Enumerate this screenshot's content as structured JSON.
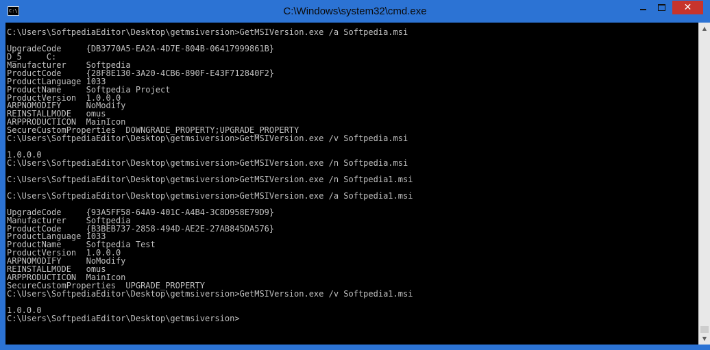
{
  "window": {
    "title": "C:\\Windows\\system32\\cmd.exe",
    "icon": "cmd-console-icon",
    "icon_label": "C:\\",
    "accent_color": "#2c73d4",
    "close_color": "#c7342c"
  },
  "controls": {
    "minimize_icon": "minimize-icon",
    "maximize_icon": "maximize-icon",
    "close_icon": "close-icon",
    "close_glyph": "✕"
  },
  "console": {
    "background": "#000000",
    "foreground": "#c0c0c0",
    "lines": [
      "C:\\Users\\SoftpediaEditor\\Desktop\\getmsiversion>GetMSIVersion.exe /a Softpedia.msi",
      "",
      "UpgradeCode     {DB3770A5-EA2A-4D7E-804B-06417999861B}",
      "D_5     C:",
      "Manufacturer    Softpedia",
      "ProductCode     {28F8E130-3A20-4CB6-890F-E43F712840F2}",
      "ProductLanguage 1033",
      "ProductName     Softpedia Project",
      "ProductVersion  1.0.0.0",
      "ARPNOMODIFY     NoModify",
      "REINSTALLMODE   omus",
      "ARPPRODUCTICON  MainIcon",
      "SecureCustomProperties  DOWNGRADE_PROPERTY;UPGRADE_PROPERTY",
      "C:\\Users\\SoftpediaEditor\\Desktop\\getmsiversion>GetMSIVersion.exe /v Softpedia.msi",
      "",
      "1.0.0.0",
      "C:\\Users\\SoftpediaEditor\\Desktop\\getmsiversion>GetMSIVersion.exe /n Softpedia.msi",
      "",
      "C:\\Users\\SoftpediaEditor\\Desktop\\getmsiversion>GetMSIVersion.exe /n Softpedia1.msi",
      "",
      "C:\\Users\\SoftpediaEditor\\Desktop\\getmsiversion>GetMSIVersion.exe /a Softpedia1.msi",
      "",
      "UpgradeCode     {93A5FF58-64A9-401C-A4B4-3C8D958E79D9}",
      "Manufacturer    Softpedia",
      "ProductCode     {B3BEB737-2858-494D-AE2E-27AB845DA576}",
      "ProductLanguage 1033",
      "ProductName     Softpedia Test",
      "ProductVersion  1.0.0.0",
      "ARPNOMODIFY     NoModify",
      "REINSTALLMODE   omus",
      "ARPPRODUCTICON  MainIcon",
      "SecureCustomProperties  UPGRADE_PROPERTY",
      "C:\\Users\\SoftpediaEditor\\Desktop\\getmsiversion>GetMSIVersion.exe /v Softpedia1.msi",
      "",
      "1.0.0.0",
      "C:\\Users\\SoftpediaEditor\\Desktop\\getmsiversion>"
    ]
  },
  "scrollbar": {
    "up_icon": "scroll-up-arrow-icon",
    "down_icon": "scroll-down-arrow-icon",
    "up_glyph": "▲",
    "down_glyph": "▼"
  }
}
